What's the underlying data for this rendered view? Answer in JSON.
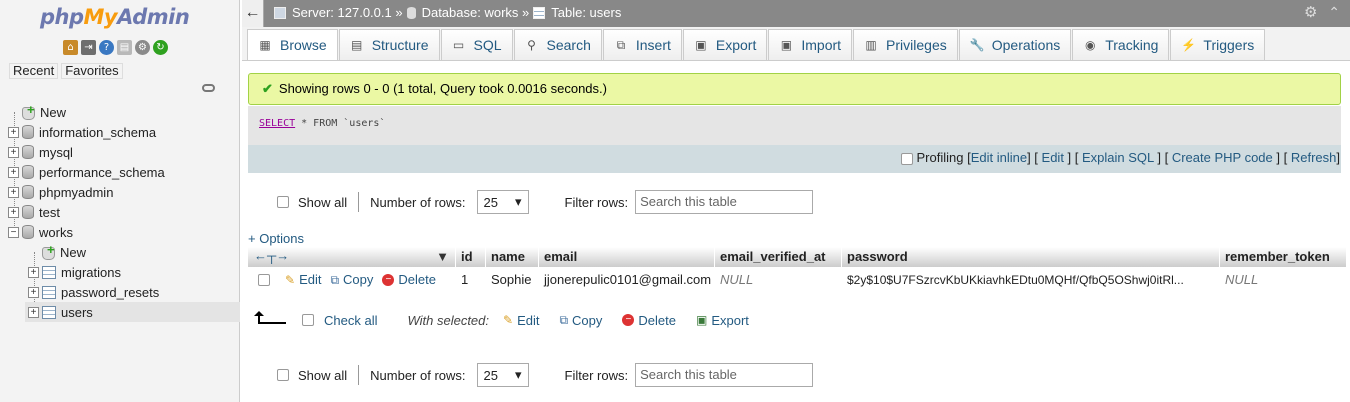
{
  "nav": {
    "logo": {
      "php": "php",
      "my": "My",
      "admin": "Admin"
    },
    "recent": "Recent",
    "favorites": "Favorites",
    "tree": [
      {
        "label": "New",
        "level": 0,
        "kind": "new"
      },
      {
        "label": "information_schema",
        "level": 0,
        "kind": "db"
      },
      {
        "label": "mysql",
        "level": 0,
        "kind": "db"
      },
      {
        "label": "performance_schema",
        "level": 0,
        "kind": "db"
      },
      {
        "label": "phpmyadmin",
        "level": 0,
        "kind": "db"
      },
      {
        "label": "test",
        "level": 0,
        "kind": "db"
      },
      {
        "label": "works",
        "level": 0,
        "kind": "db-open"
      },
      {
        "label": "New",
        "level": 1,
        "kind": "new"
      },
      {
        "label": "migrations",
        "level": 1,
        "kind": "table"
      },
      {
        "label": "password_resets",
        "level": 1,
        "kind": "table"
      },
      {
        "label": "users",
        "level": 1,
        "kind": "table-active"
      }
    ]
  },
  "topbar": {
    "server": "Server: 127.0.0.1 »",
    "database": "Database: works »",
    "table": "Table: users"
  },
  "tabs": [
    {
      "label": "Browse",
      "icon": "browse-icon"
    },
    {
      "label": "Structure",
      "icon": "structure-icon"
    },
    {
      "label": "SQL",
      "icon": "sql-icon"
    },
    {
      "label": "Search",
      "icon": "search-icon"
    },
    {
      "label": "Insert",
      "icon": "insert-icon"
    },
    {
      "label": "Export",
      "icon": "export-icon"
    },
    {
      "label": "Import",
      "icon": "import-icon"
    },
    {
      "label": "Privileges",
      "icon": "privileges-icon"
    },
    {
      "label": "Operations",
      "icon": "operations-icon"
    },
    {
      "label": "Tracking",
      "icon": "tracking-icon"
    },
    {
      "label": "Triggers",
      "icon": "triggers-icon"
    }
  ],
  "message": "Showing rows 0 - 0 (1 total, Query took 0.0016 seconds.)",
  "sql": {
    "keyword": "SELECT",
    "rest": " * FROM `users`"
  },
  "profiling": {
    "label": "Profiling",
    "edit_inline": "Edit inline",
    "edit": "Edit",
    "explain": "Explain SQL",
    "create_php": "Create PHP code",
    "refresh": "Refresh"
  },
  "navbar": {
    "show_all": "Show all",
    "num_rows_label": "Number of rows:",
    "num_rows_value": "25",
    "filter_label": "Filter rows:",
    "filter_placeholder": "Search this table"
  },
  "options_link": "+ Options",
  "columns": [
    "id",
    "name",
    "email",
    "email_verified_at",
    "password",
    "remember_token"
  ],
  "row": {
    "actions": {
      "edit": "Edit",
      "copy": "Copy",
      "delete": "Delete"
    },
    "id": "1",
    "name": "Sophie",
    "email": "jjonerepulic0101@gmail.com",
    "email_verified_at": "NULL",
    "password": "$2y$10$U7FSzrcvKbUKkiavhkEDtu0MQHf/QfbQ5OShwj0itRl...",
    "remember_token": "NULL"
  },
  "with_selected": {
    "check_all": "Check all",
    "label": "With selected:",
    "edit": "Edit",
    "copy": "Copy",
    "delete": "Delete",
    "export": "Export"
  }
}
